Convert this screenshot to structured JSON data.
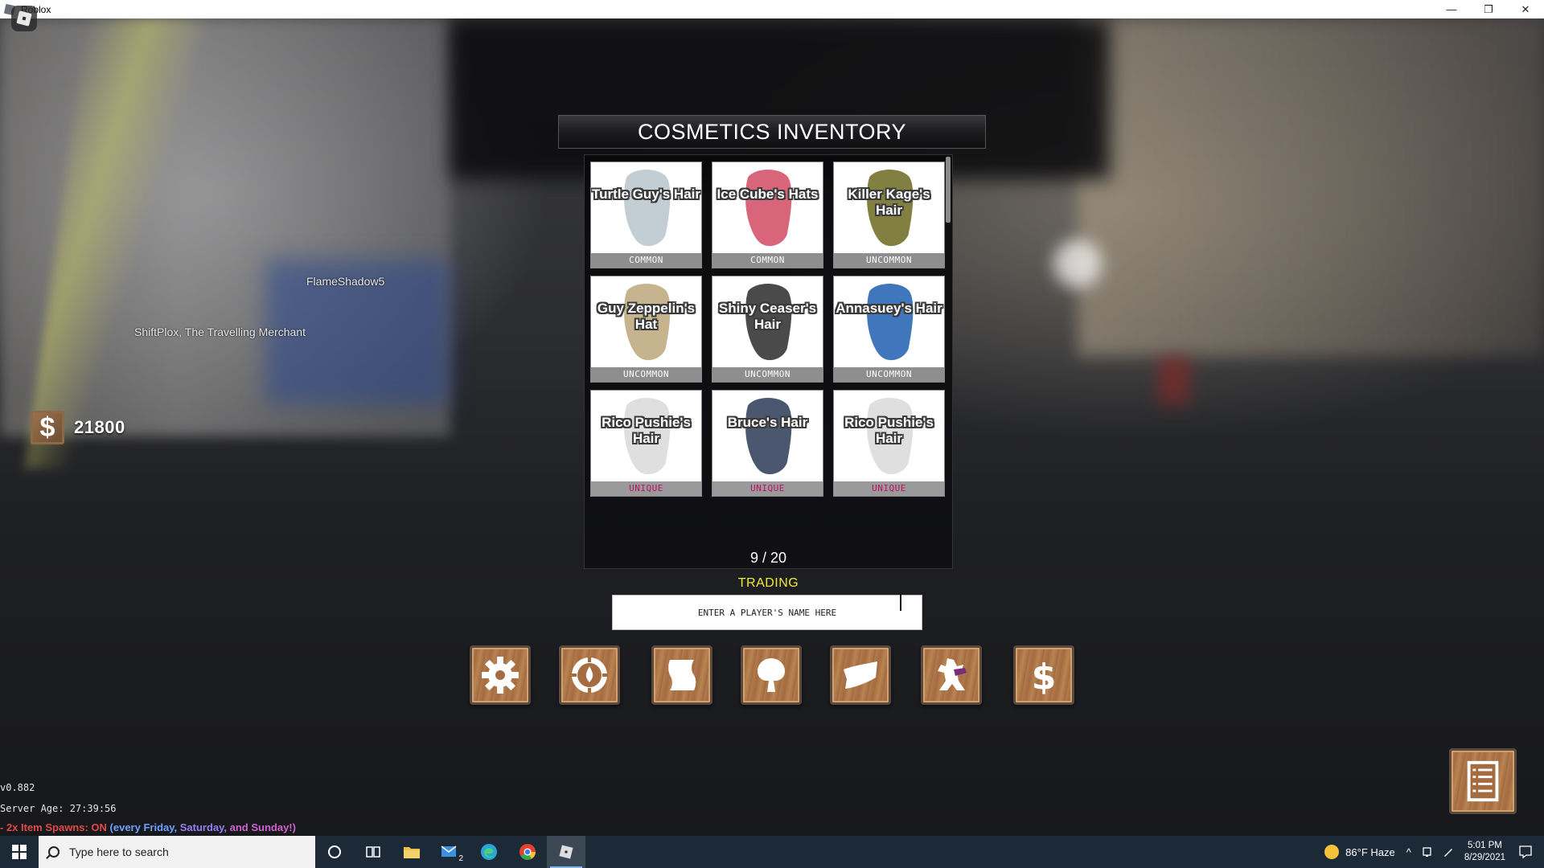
{
  "window": {
    "title": "Roblox",
    "minimize_glyph": "—",
    "restore_glyph": "❐",
    "close_glyph": "✕"
  },
  "world": {
    "player_tag": "FlameShadow5",
    "npc_tag": "ShiftPlox, The Travelling Merchant"
  },
  "money": {
    "symbol": "$",
    "amount": "21800"
  },
  "inventory": {
    "title": "COSMETICS INVENTORY",
    "page_count": "9 / 20",
    "items": [
      {
        "name": "Turtle Guy's Hair",
        "rarity": "COMMON",
        "color": "#b9c4cc"
      },
      {
        "name": "Ice Cube's Hats",
        "rarity": "COMMON",
        "color": "#d24a63"
      },
      {
        "name": "Killer Kage's Hair",
        "rarity": "UNCOMMON",
        "color": "#6b6a1f"
      },
      {
        "name": "Guy Zeppelin's Hat",
        "rarity": "UNCOMMON",
        "color": "#bba77a"
      },
      {
        "name": "Shiny Ceaser's Hair",
        "rarity": "UNCOMMON",
        "color": "#2a2a2a"
      },
      {
        "name": "Annasuey's Hair",
        "rarity": "UNCOMMON",
        "color": "#1f5fb0"
      },
      {
        "name": "Rico Pushie's Hair",
        "rarity": "UNIQUE",
        "color": "#d9d9d9"
      },
      {
        "name": "Bruce's Hair",
        "rarity": "UNIQUE",
        "color": "#2b3a56"
      },
      {
        "name": "Rico Pushie's Hair",
        "rarity": "UNIQUE",
        "color": "#d9d9d9"
      }
    ]
  },
  "trading": {
    "label": "TRADING",
    "placeholder": "ENTER A PLAYER'S NAME HERE"
  },
  "menu_buttons": [
    {
      "icon": "gear-icon"
    },
    {
      "icon": "compass-icon"
    },
    {
      "icon": "scroll-icon"
    },
    {
      "icon": "tree-icon"
    },
    {
      "icon": "banner-icon"
    },
    {
      "icon": "stand-icon"
    },
    {
      "icon": "dollar-icon"
    }
  ],
  "status": {
    "version": "v0.882",
    "server_age": "Server Age: 27:39:56",
    "spawn_prefix": "- 2x Item Spawns: ",
    "spawn_on": "ON",
    "spawn_days_1": " (every Friday, ",
    "spawn_days_2": "Saturday, ",
    "spawn_days_3": "and Sunday!)"
  },
  "taskbar": {
    "search_placeholder": "Type here to search",
    "mail_badge": "2",
    "weather": "86°F  Haze",
    "time": "5:01 PM",
    "date": "8/29/2021"
  },
  "colors": {
    "trading_label": "#f4e83a",
    "unique_rarity": "#c0106a",
    "taskbar": "#1c2a38"
  }
}
